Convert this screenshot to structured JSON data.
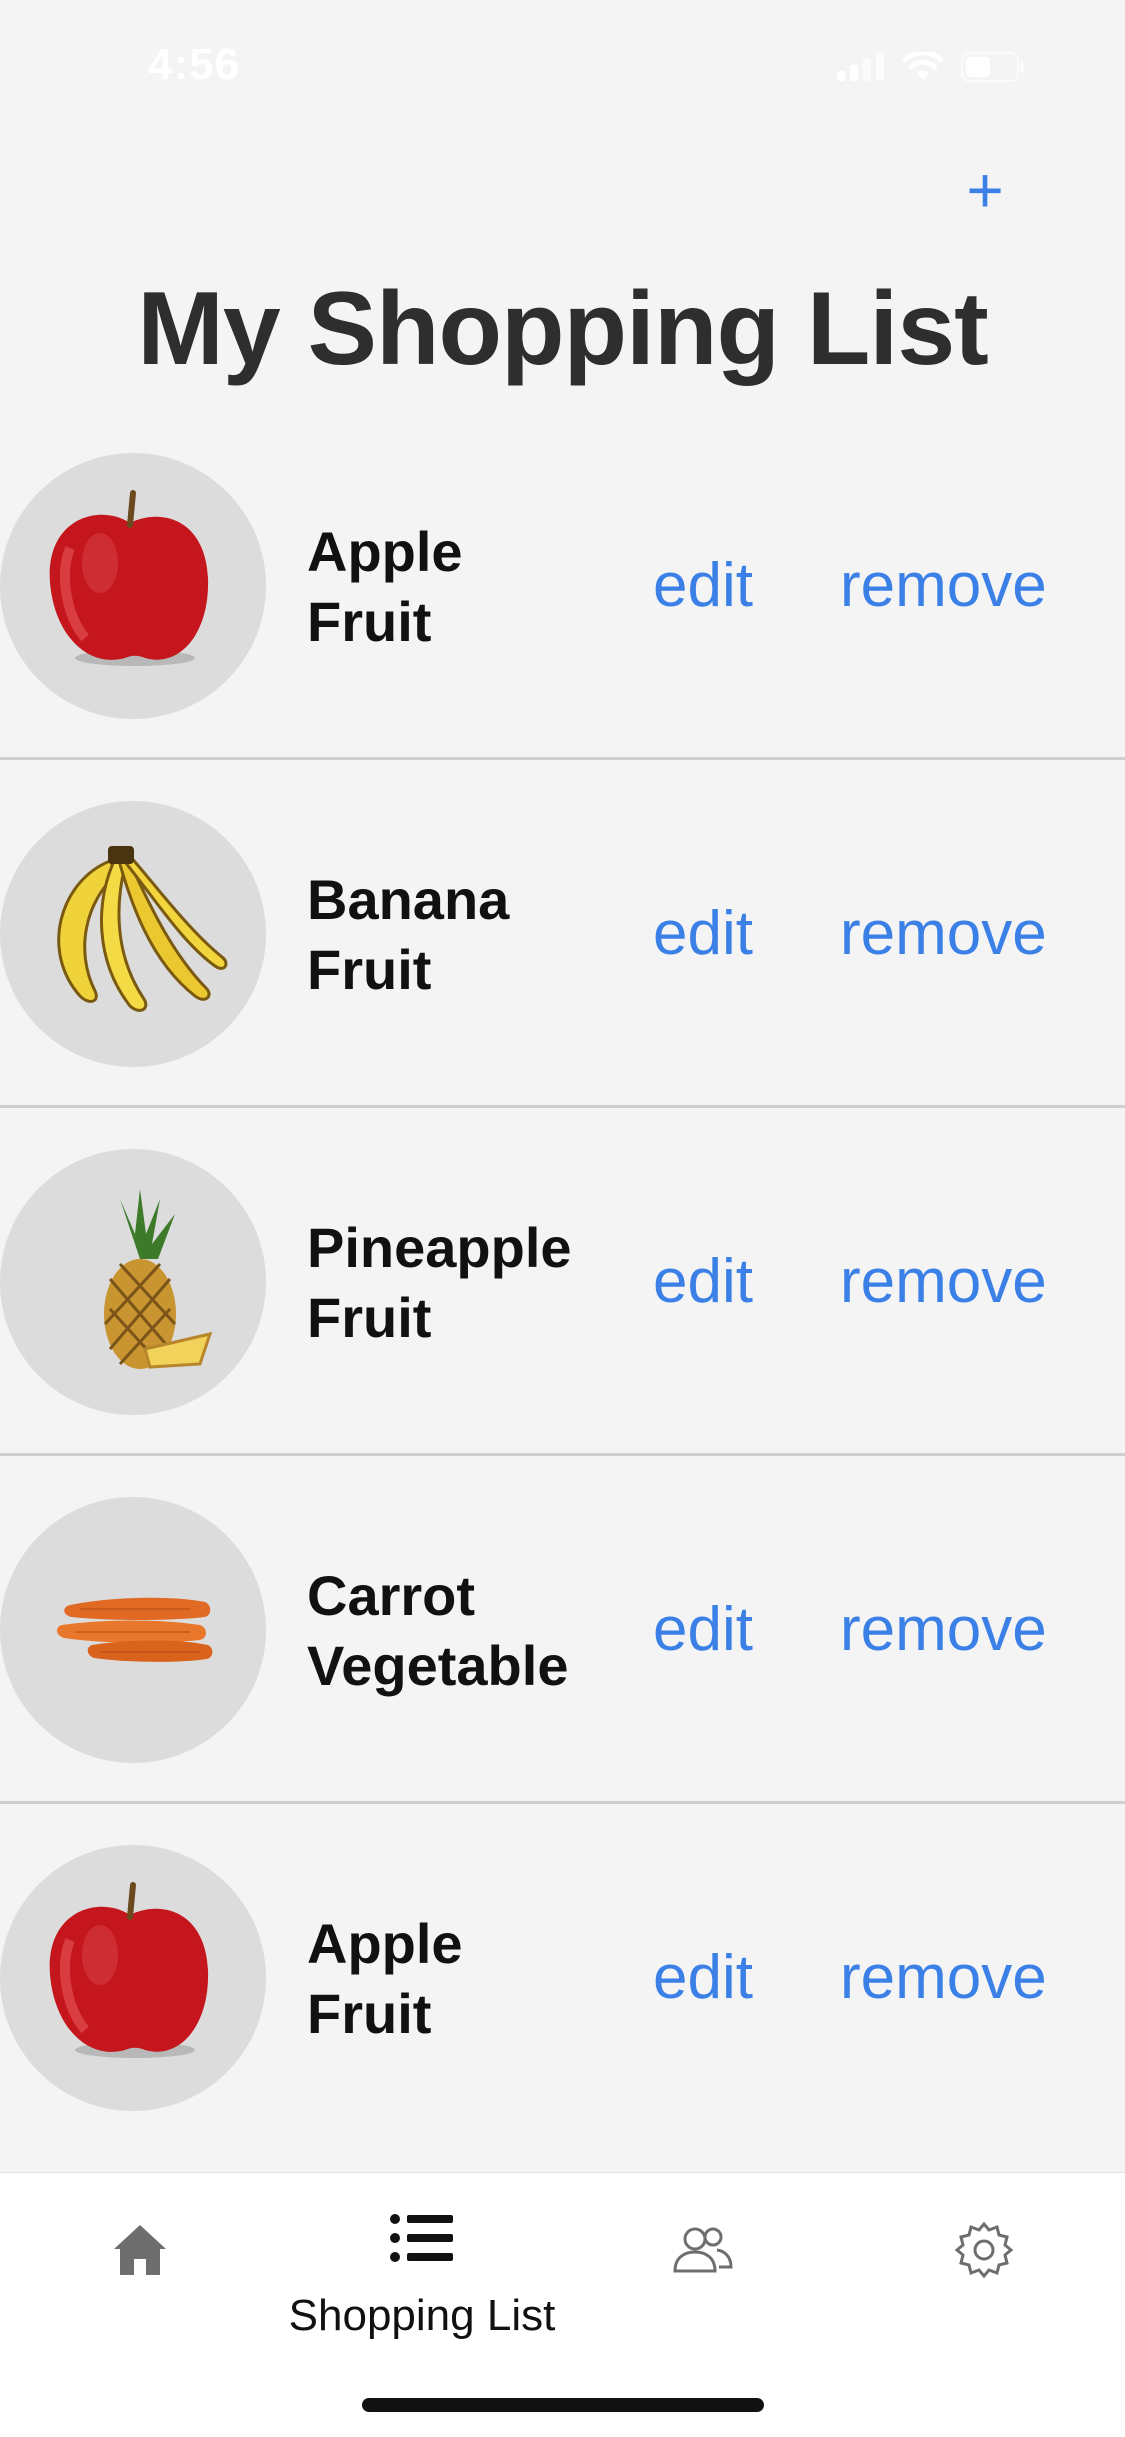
{
  "status_bar": {
    "time": "4:56"
  },
  "header": {
    "add_label": "+",
    "title": "My Shopping List"
  },
  "items": [
    {
      "name": "Apple",
      "category": "Fruit",
      "image": "apple",
      "edit_label": "edit",
      "remove_label": "remove"
    },
    {
      "name": "Banana",
      "category": "Fruit",
      "image": "banana",
      "edit_label": "edit",
      "remove_label": "remove"
    },
    {
      "name": "Pineapple",
      "category": "Fruit",
      "image": "pineapple",
      "edit_label": "edit",
      "remove_label": "remove"
    },
    {
      "name": "Carrot",
      "category": "Vegetable",
      "image": "carrot",
      "edit_label": "edit",
      "remove_label": "remove"
    },
    {
      "name": "Apple",
      "category": "Fruit",
      "image": "apple",
      "edit_label": "edit",
      "remove_label": "remove"
    }
  ],
  "tab_bar": {
    "tabs": [
      {
        "icon": "home-icon"
      },
      {
        "icon": "list-icon",
        "label": "Shopping List"
      },
      {
        "icon": "people-icon"
      },
      {
        "icon": "gear-icon"
      }
    ]
  },
  "colors": {
    "accent": "#3a80e6",
    "background": "#f4f4f4",
    "avatar_bg": "#dcdcdc",
    "divider": "#cfcfcf"
  }
}
